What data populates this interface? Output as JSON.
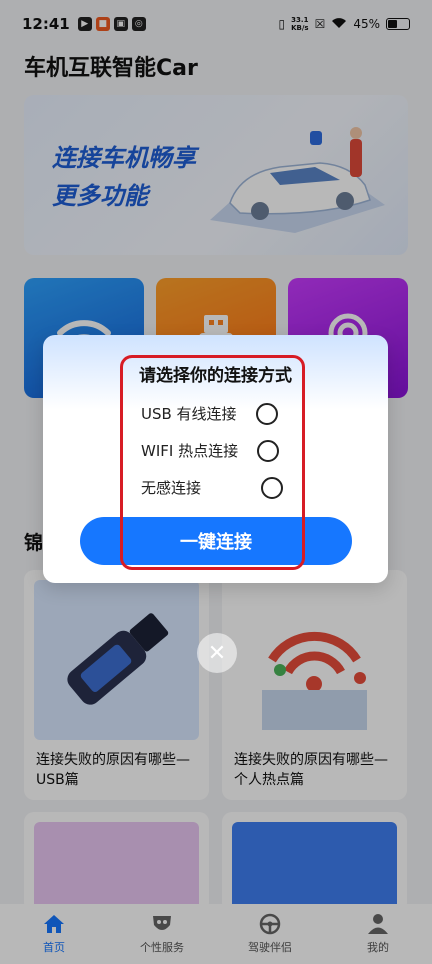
{
  "status_bar": {
    "time": "12:41",
    "net_speed_value": "33.1",
    "net_speed_unit": "KB/s",
    "battery": "45%"
  },
  "app": {
    "title": "车机互联智能Car"
  },
  "banner": {
    "line1": "连接车机畅享",
    "line2": "更多功能"
  },
  "section": {
    "title_partial": "锦"
  },
  "cards": [
    {
      "caption": "连接失败的原因有哪些—USB篇"
    },
    {
      "caption": "连接失败的原因有哪些—个人热点篇"
    }
  ],
  "dialog": {
    "title": "请选择你的连接方式",
    "options": [
      {
        "label": "USB 有线连接",
        "selected": false
      },
      {
        "label": "WIFI 热点连接",
        "selected": false
      },
      {
        "label": "无感连接",
        "selected": false
      }
    ],
    "button_label": "一键连接",
    "close_icon": "close-icon"
  },
  "bottom_nav": {
    "items": [
      {
        "label": "首页",
        "icon": "home-icon",
        "active": true
      },
      {
        "label": "个性服务",
        "icon": "mask-icon",
        "active": false
      },
      {
        "label": "驾驶伴侣",
        "icon": "steering-wheel-icon",
        "active": false
      },
      {
        "label": "我的",
        "icon": "user-icon",
        "active": false
      }
    ]
  },
  "colors": {
    "accent": "#1677ff",
    "highlight": "#d71c25",
    "tile_wifi": "#1f7be8",
    "tile_usb": "#ff8420",
    "tile_hotspot": "#a826ee"
  }
}
